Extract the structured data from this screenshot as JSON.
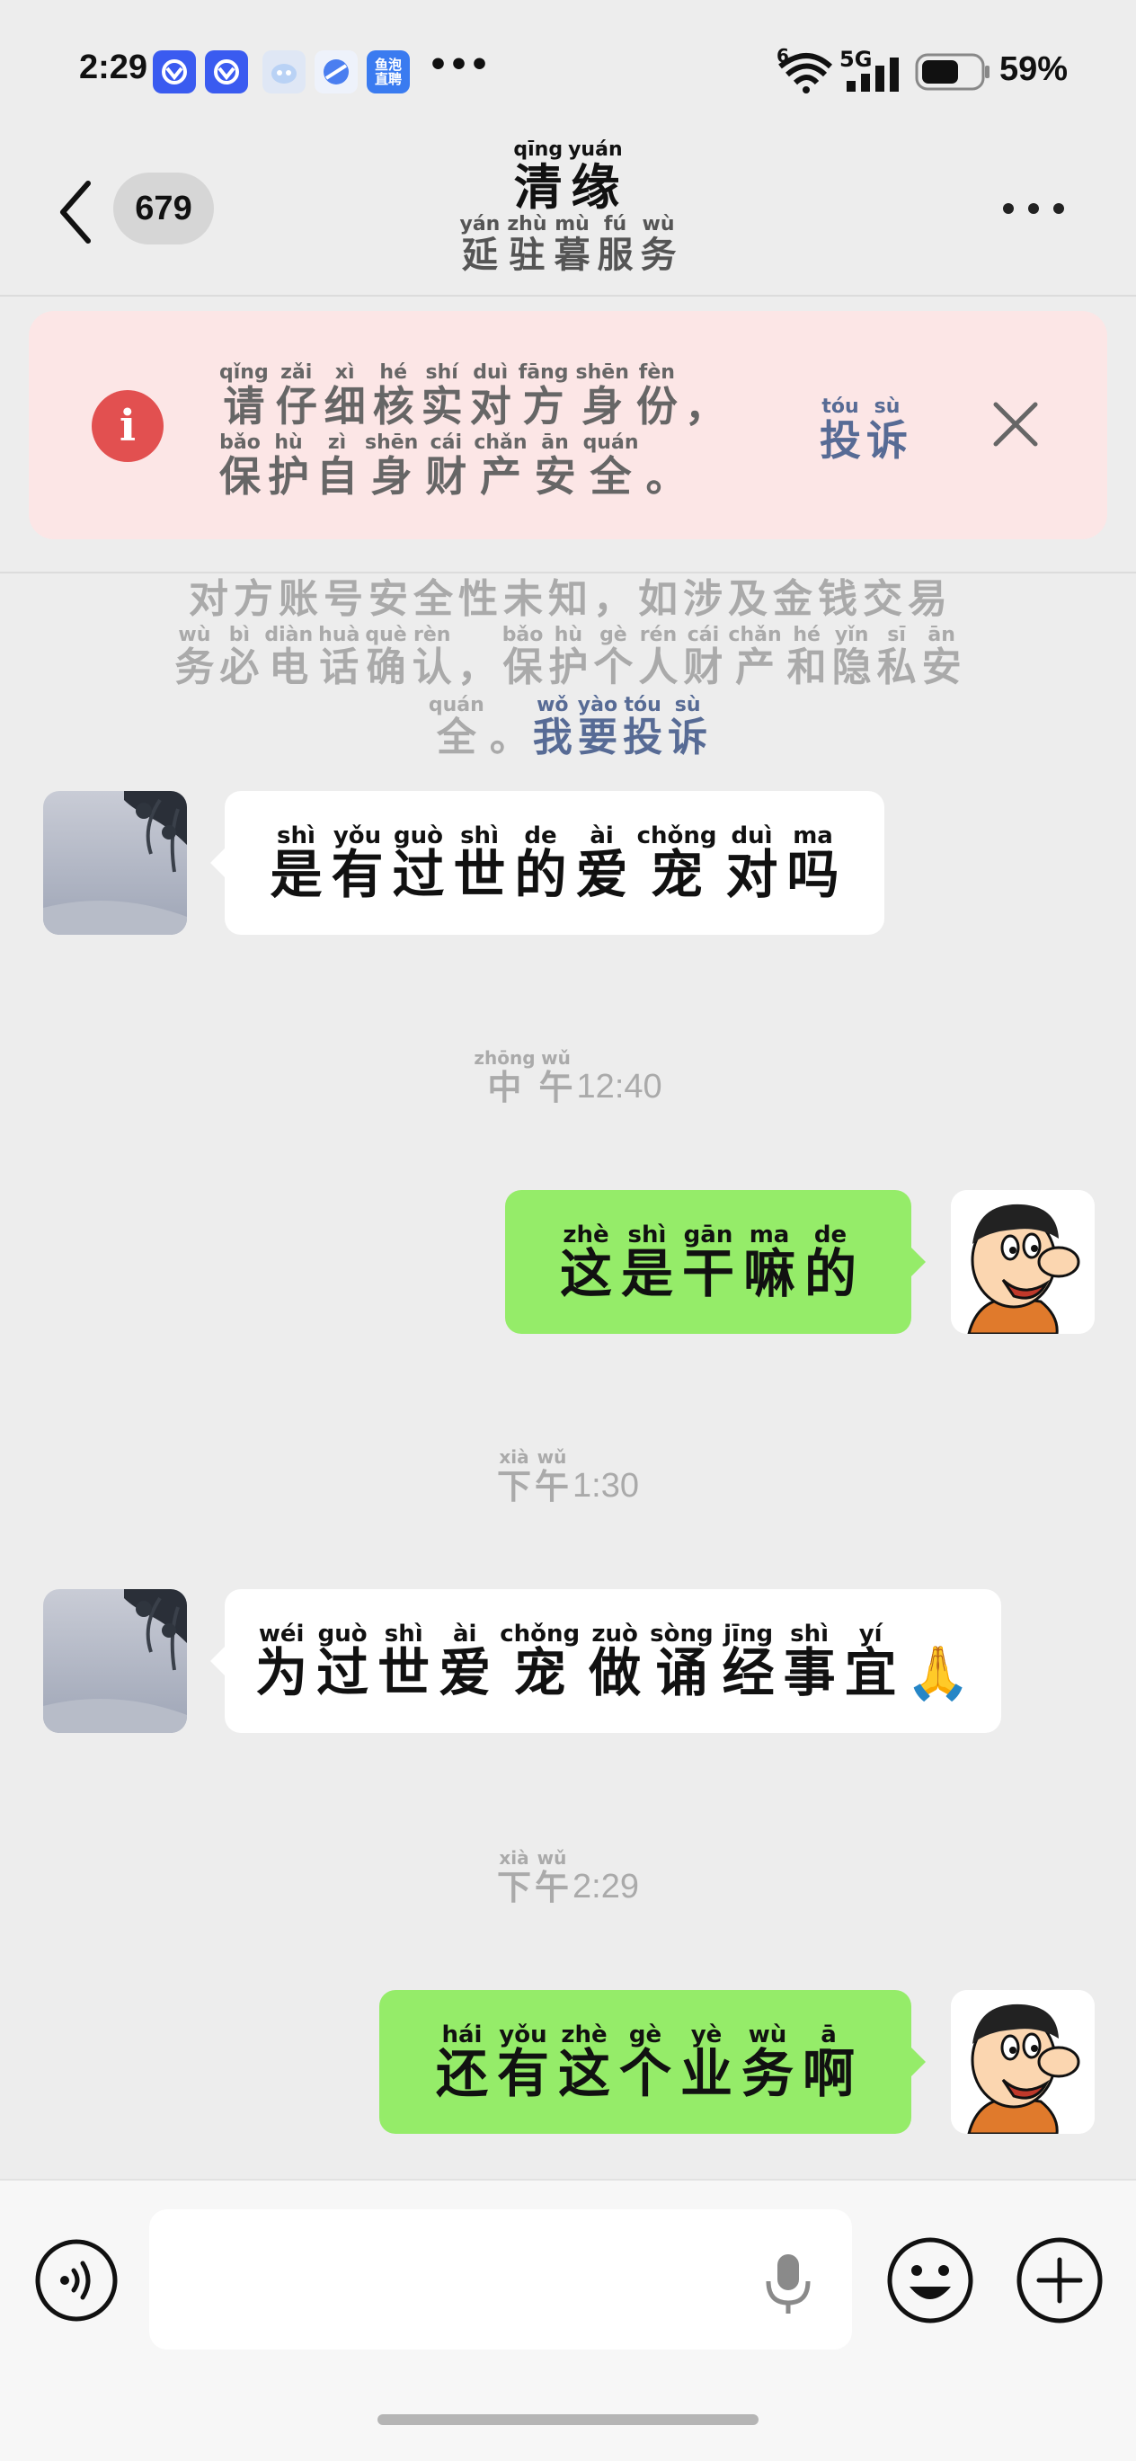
{
  "status_bar": {
    "time": "2:29",
    "app_icon_badge": "鱼泡\n直聘",
    "more": "•••",
    "wifi_badge": "6",
    "network": "5G",
    "battery": "59%"
  },
  "header": {
    "unread_count": "679",
    "title": [
      {
        "py": "qīng",
        "hz": "清"
      },
      {
        "py": "yuán",
        "hz": "缘"
      }
    ],
    "subtitle": [
      {
        "py": "yán",
        "hz": "延"
      },
      {
        "py": "zhù",
        "hz": "驻"
      },
      {
        "py": "mù",
        "hz": "暮"
      },
      {
        "py": "fú",
        "hz": "服"
      },
      {
        "py": "wù",
        "hz": "务"
      }
    ]
  },
  "banner": {
    "line1": [
      {
        "py": "qǐng",
        "hz": "请"
      },
      {
        "py": "zǎi",
        "hz": "仔"
      },
      {
        "py": "xì",
        "hz": "细"
      },
      {
        "py": "hé",
        "hz": "核"
      },
      {
        "py": "shí",
        "hz": "实"
      },
      {
        "py": "duì",
        "hz": "对"
      },
      {
        "py": "fāng",
        "hz": "方"
      },
      {
        "py": "shēn",
        "hz": "身"
      },
      {
        "py": "fèn",
        "hz": "份"
      },
      {
        "py": "",
        "hz": "，"
      }
    ],
    "line2": [
      {
        "py": "bǎo",
        "hz": "保"
      },
      {
        "py": "hù",
        "hz": "护"
      },
      {
        "py": "zì",
        "hz": "自"
      },
      {
        "py": "shēn",
        "hz": "身"
      },
      {
        "py": "cái",
        "hz": "财"
      },
      {
        "py": "chǎn",
        "hz": "产"
      },
      {
        "py": "ān",
        "hz": "安"
      },
      {
        "py": "quán",
        "hz": "全"
      },
      {
        "py": "",
        "hz": "。"
      }
    ],
    "complain": [
      {
        "py": "tóu",
        "hz": "投"
      },
      {
        "py": "sù",
        "hz": "诉"
      }
    ]
  },
  "notice": {
    "line1": [
      {
        "py": "",
        "hz": "对"
      },
      {
        "py": "",
        "hz": "方"
      },
      {
        "py": "",
        "hz": "账"
      },
      {
        "py": "",
        "hz": "号"
      },
      {
        "py": "",
        "hz": "安"
      },
      {
        "py": "",
        "hz": "全"
      },
      {
        "py": "",
        "hz": "性"
      },
      {
        "py": "",
        "hz": "未"
      },
      {
        "py": "",
        "hz": "知"
      },
      {
        "py": "",
        "hz": "，"
      },
      {
        "py": "",
        "hz": "如"
      },
      {
        "py": "",
        "hz": "涉"
      },
      {
        "py": "",
        "hz": "及"
      },
      {
        "py": "",
        "hz": "金"
      },
      {
        "py": "",
        "hz": "钱"
      },
      {
        "py": "",
        "hz": "交"
      },
      {
        "py": "",
        "hz": "易"
      }
    ],
    "line2": [
      {
        "py": "wù",
        "hz": "务"
      },
      {
        "py": "bì",
        "hz": "必"
      },
      {
        "py": "diàn",
        "hz": "电"
      },
      {
        "py": "huà",
        "hz": "话"
      },
      {
        "py": "què",
        "hz": "确"
      },
      {
        "py": "rèn",
        "hz": "认"
      },
      {
        "py": "",
        "hz": "，"
      },
      {
        "py": "bǎo",
        "hz": "保"
      },
      {
        "py": "hù",
        "hz": "护"
      },
      {
        "py": "gè",
        "hz": "个"
      },
      {
        "py": "rén",
        "hz": "人"
      },
      {
        "py": "cái",
        "hz": "财"
      },
      {
        "py": "chǎn",
        "hz": "产"
      },
      {
        "py": "hé",
        "hz": "和"
      },
      {
        "py": "yǐn",
        "hz": "隐"
      },
      {
        "py": "sī",
        "hz": "私"
      },
      {
        "py": "ān",
        "hz": "安"
      }
    ],
    "line3": [
      {
        "py": "quán",
        "hz": "全"
      },
      {
        "py": "",
        "hz": "。"
      }
    ],
    "link": [
      {
        "py": "wǒ",
        "hz": "我"
      },
      {
        "py": "yào",
        "hz": "要"
      },
      {
        "py": "tóu",
        "hz": "投"
      },
      {
        "py": "sù",
        "hz": "诉"
      }
    ]
  },
  "messages": [
    {
      "type": "in",
      "chars": [
        {
          "py": "shì",
          "hz": "是"
        },
        {
          "py": "yǒu",
          "hz": "有"
        },
        {
          "py": "guò",
          "hz": "过"
        },
        {
          "py": "shì",
          "hz": "世"
        },
        {
          "py": "de",
          "hz": "的"
        },
        {
          "py": "ài",
          "hz": "爱"
        },
        {
          "py": "chǒng",
          "hz": "宠"
        },
        {
          "py": "duì",
          "hz": "对"
        },
        {
          "py": "ma",
          "hz": "吗"
        }
      ]
    },
    {
      "type": "time",
      "chars": [
        {
          "py": "zhōng",
          "hz": "中"
        },
        {
          "py": "wǔ",
          "hz": "午"
        }
      ],
      "time": "12:40"
    },
    {
      "type": "out",
      "chars": [
        {
          "py": "zhè",
          "hz": "这"
        },
        {
          "py": "shì",
          "hz": "是"
        },
        {
          "py": "gān",
          "hz": "干"
        },
        {
          "py": "ma",
          "hz": "嘛"
        },
        {
          "py": "de",
          "hz": "的"
        }
      ]
    },
    {
      "type": "time",
      "chars": [
        {
          "py": "xià",
          "hz": "下"
        },
        {
          "py": "wǔ",
          "hz": "午"
        }
      ],
      "time": "1:30"
    },
    {
      "type": "in",
      "chars": [
        {
          "py": "wéi",
          "hz": "为"
        },
        {
          "py": "guò",
          "hz": "过"
        },
        {
          "py": "shì",
          "hz": "世"
        },
        {
          "py": "ài",
          "hz": "爱"
        },
        {
          "py": "chǒng",
          "hz": "宠"
        },
        {
          "py": "zuò",
          "hz": "做"
        },
        {
          "py": "sòng",
          "hz": "诵"
        },
        {
          "py": "jīng",
          "hz": "经"
        },
        {
          "py": "shì",
          "hz": "事"
        },
        {
          "py": "yí",
          "hz": "宜"
        },
        {
          "py": "",
          "hz": "🙏"
        }
      ]
    },
    {
      "type": "time",
      "chars": [
        {
          "py": "xià",
          "hz": "下"
        },
        {
          "py": "wǔ",
          "hz": "午"
        }
      ],
      "time": "2:29"
    },
    {
      "type": "out",
      "chars": [
        {
          "py": "hái",
          "hz": "还"
        },
        {
          "py": "yǒu",
          "hz": "有"
        },
        {
          "py": "zhè",
          "hz": "这"
        },
        {
          "py": "gè",
          "hz": "个"
        },
        {
          "py": "yè",
          "hz": "业"
        },
        {
          "py": "wù",
          "hz": "务"
        },
        {
          "py": "ā",
          "hz": "啊"
        }
      ]
    }
  ],
  "input_bar": {
    "text_value": ""
  },
  "colors": {
    "background": "#ededed",
    "bubble_out": "#95ec69",
    "bubble_in": "#ffffff",
    "link": "#576b95",
    "warning": "#e25050"
  }
}
